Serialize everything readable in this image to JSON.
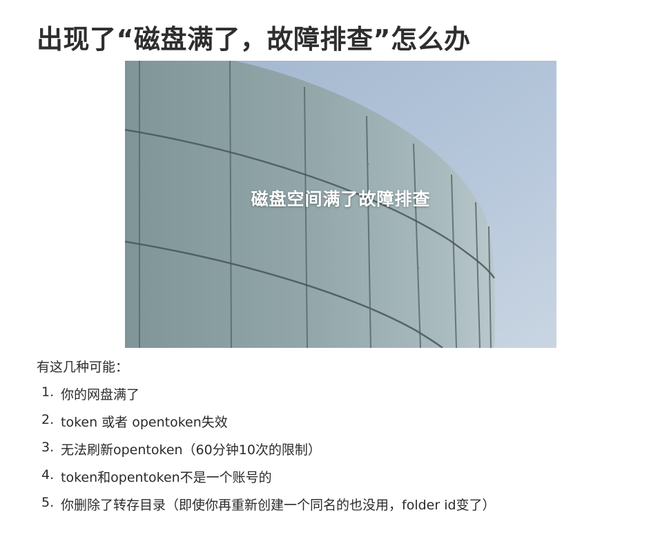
{
  "title": "出现了“磁盘满了，故障排查”怎么办",
  "hero": {
    "caption": "磁盘空间满了故障排查"
  },
  "intro": "有这几种可能：",
  "reasons": [
    {
      "num": "1.",
      "text": "你的网盘满了"
    },
    {
      "num": "2.",
      "text": "token 或者 opentoken失效"
    },
    {
      "num": "3.",
      "text": "无法刷新opentoken（60分钟10次的限制）"
    },
    {
      "num": "4.",
      "text": "token和opentoken不是一个账号的"
    },
    {
      "num": "5.",
      "text": "你删除了转存目录（即使你再重新创建一个同名的也没用，folder id变了）"
    }
  ]
}
